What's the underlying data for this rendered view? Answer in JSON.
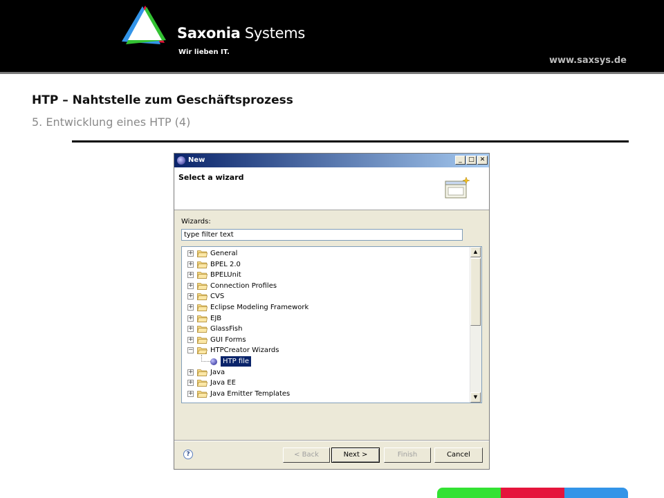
{
  "header": {
    "brand_bold": "Saxonia",
    "brand_rest": "Systems",
    "tagline": "Wir lieben IT.",
    "website": "www.saxsys.de"
  },
  "slide": {
    "title": "HTP – Nahtstelle zum Geschäftsprozess",
    "subtitle": "5. Entwicklung eines HTP (4)"
  },
  "dialog": {
    "window_title": "New",
    "banner_title": "Select a wizard",
    "wizards_label": "Wizards:",
    "filter_value": "type filter text",
    "tree_items": [
      {
        "label": "General",
        "expanded": false
      },
      {
        "label": "BPEL 2.0",
        "expanded": false
      },
      {
        "label": "BPELUnit",
        "expanded": false
      },
      {
        "label": "Connection Profiles",
        "expanded": false
      },
      {
        "label": "CVS",
        "expanded": false
      },
      {
        "label": "Eclipse Modeling Framework",
        "expanded": false
      },
      {
        "label": "EJB",
        "expanded": false
      },
      {
        "label": "GlassFish",
        "expanded": false
      },
      {
        "label": "GUI Forms",
        "expanded": false
      },
      {
        "label": "HTPCreator Wizards",
        "expanded": true
      },
      {
        "label": "HTP file",
        "child": true,
        "selected": true
      },
      {
        "label": "Java",
        "expanded": false
      },
      {
        "label": "Java EE",
        "expanded": false
      },
      {
        "label": "Java Emitter Templates",
        "expanded": false
      }
    ],
    "buttons": {
      "help": "?",
      "back": "< Back",
      "next": "Next >",
      "finish": "Finish",
      "cancel": "Cancel"
    }
  },
  "colors": {
    "bar_green": "#33e233",
    "bar_red": "#e5143c",
    "bar_blue": "#3394e8",
    "selection": "#0a246a"
  }
}
